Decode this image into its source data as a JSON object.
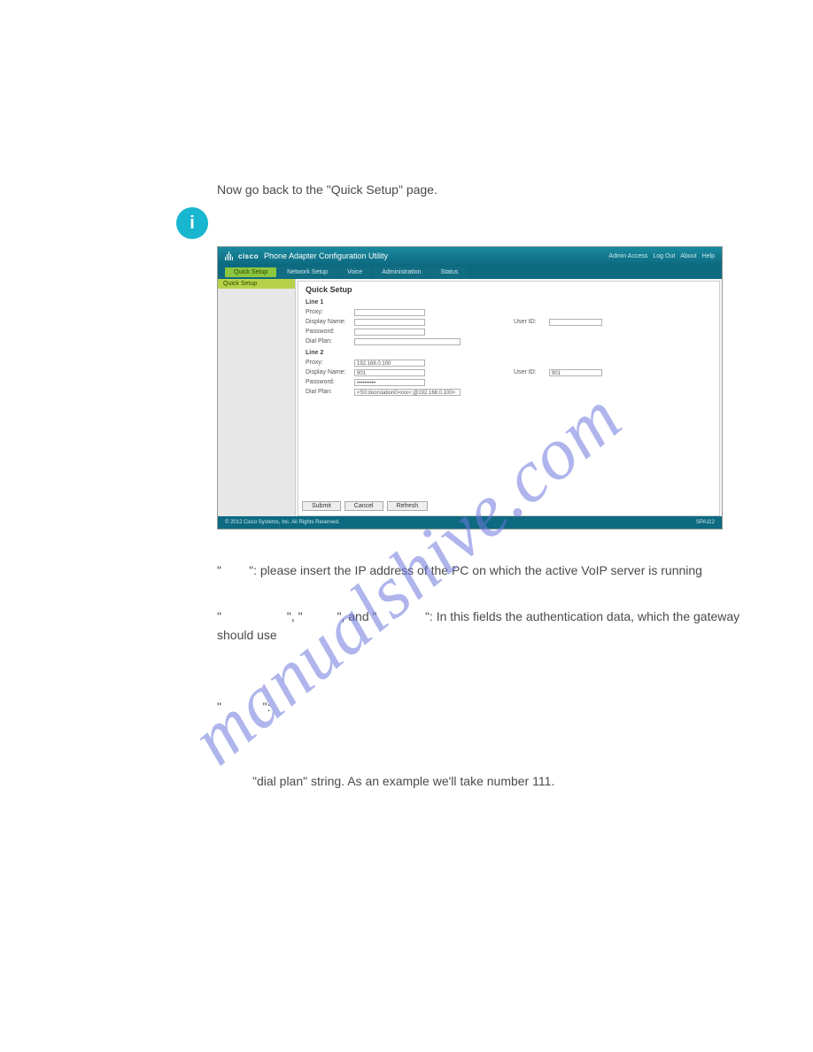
{
  "intro_text": "Now go back to the \"Quick Setup\" page.",
  "watermark": "manualshive.com",
  "screenshot": {
    "brand": "cisco",
    "app_title": "Phone Adapter Configuration Utility",
    "header_links": [
      "Admin Access",
      "Log Out",
      "About",
      "Help"
    ],
    "tabs": [
      {
        "label": "Quick Setup",
        "active": true
      },
      {
        "label": "Network Setup",
        "active": false
      },
      {
        "label": "Voice",
        "active": false
      },
      {
        "label": "Administration",
        "active": false
      },
      {
        "label": "Status",
        "active": false
      }
    ],
    "sidebar_item": "Quick Setup",
    "page_title": "Quick Setup",
    "line1": {
      "section": "Line 1",
      "proxy_label": "Proxy:",
      "proxy_value": "",
      "display_name_label": "Display Name:",
      "display_name_value": "",
      "user_id_label": "User ID:",
      "user_id_value": "",
      "password_label": "Password:",
      "password_value": "",
      "dial_plan_label": "Dial Plan:",
      "dial_plan_value": ""
    },
    "line2": {
      "section": "Line 2",
      "proxy_label": "Proxy:",
      "proxy_value": "192.168.0.100",
      "display_name_label": "Display Name:",
      "display_name_value": "901",
      "user_id_label": "User ID:",
      "user_id_value": "901",
      "password_label": "Password:",
      "password_value": "••••••••••",
      "dial_plan_label": "Dial Plan:",
      "dial_plan_value": "<S0:doorstation0>xxx<:@192.168.0.100>"
    },
    "buttons": {
      "submit": "Submit",
      "cancel": "Cancel",
      "refresh": "Refresh"
    },
    "copyright": "© 2012 Cisco Systems, Inc. All Rights Reserved.",
    "model": "SPA112"
  },
  "para1_prefix": "\"",
  "para1_suffix": "\": please insert the IP address of the PC on which the active VoIP server is running",
  "para2_a": "\"",
  "para2_b": "\", \"",
  "para2_c": "\", and \"",
  "para2_d": "\": In this fields the authentication data, which the gateway should use",
  "para3_a": "\"",
  "para3_b": "\":",
  "para4": "\"dial plan\" string. As an example we'll take number 111."
}
